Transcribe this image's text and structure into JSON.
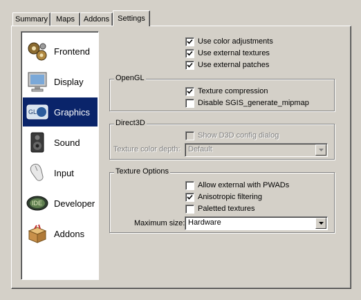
{
  "tabs": [
    {
      "label": "Summary"
    },
    {
      "label": "Maps"
    },
    {
      "label": "Addons"
    },
    {
      "label": "Settings"
    }
  ],
  "nav": {
    "items": [
      {
        "label": "Frontend",
        "icon": "gears-icon"
      },
      {
        "label": "Display",
        "icon": "monitor-icon"
      },
      {
        "label": "Graphics",
        "icon": "opengl-icon"
      },
      {
        "label": "Sound",
        "icon": "speaker-icon"
      },
      {
        "label": "Input",
        "icon": "mouse-icon"
      },
      {
        "label": "Developer",
        "icon": "ide-icon"
      },
      {
        "label": "Addons",
        "icon": "box-icon"
      }
    ],
    "selected": "Graphics",
    "selected_color": "#0a246a"
  },
  "general": {
    "use_color_adjustments": {
      "label": "Use color adjustments",
      "checked": true
    },
    "use_external_textures": {
      "label": "Use external textures",
      "checked": true
    },
    "use_external_patches": {
      "label": "Use external patches",
      "checked": true
    }
  },
  "opengl": {
    "title": "OpenGL",
    "texture_compression": {
      "label": "Texture compression",
      "checked": true
    },
    "disable_sgis": {
      "label": "Disable SGIS_generate_mipmap",
      "checked": false
    }
  },
  "direct3d": {
    "title": "Direct3D",
    "show_config": {
      "label": "Show D3D config dialog",
      "checked": false
    },
    "depth_label": "Texture color depth:",
    "depth_value": "Default"
  },
  "texture_options": {
    "title": "Texture Options",
    "allow_external": {
      "label": "Allow external with PWADs",
      "checked": false
    },
    "anisotropic": {
      "label": "Anisotropic filtering",
      "checked": true
    },
    "paletted": {
      "label": "Paletted textures",
      "checked": false
    },
    "max_size_label": "Maximum size:",
    "max_size_value": "Hardware"
  }
}
